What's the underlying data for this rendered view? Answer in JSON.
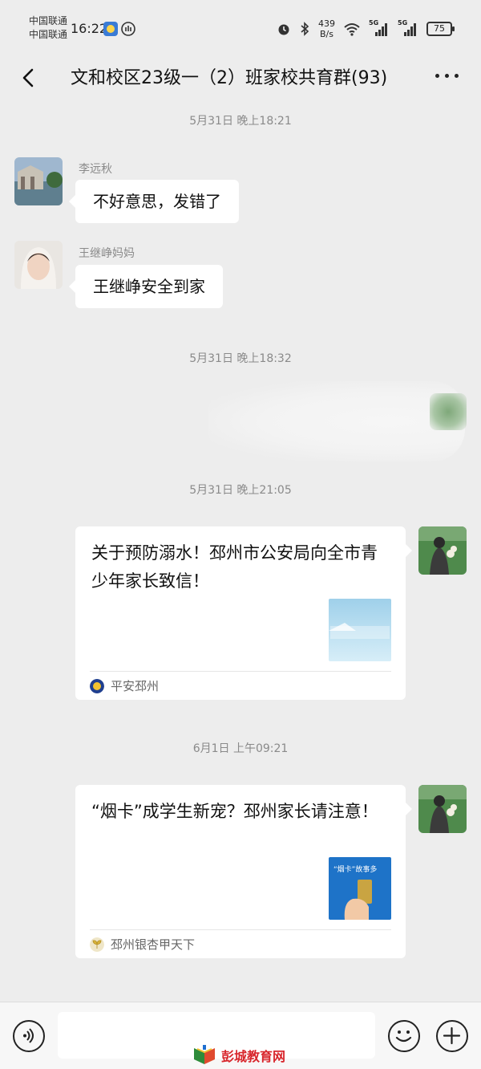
{
  "status_bar": {
    "carrier_1": "中国联通",
    "carrier_2": "中国联通",
    "time": "16:22",
    "net_speed_value": "439",
    "net_speed_unit": "B/s",
    "signal_label_1": "5G",
    "signal_label_2": "5G",
    "battery": "75"
  },
  "nav": {
    "title": "文和校区23级一（2）班家校共育群(93)"
  },
  "timestamps": {
    "t1": "5月31日 晚上18:21",
    "t2": "5月31日 晚上18:32",
    "t3": "5月31日 晚上21:05",
    "t4": "6月1日 上午09:21"
  },
  "messages": [
    {
      "sender": "李远秋",
      "text": "不好意思，发错了"
    },
    {
      "sender": "王继峥妈妈",
      "text": "王继峥安全到家"
    }
  ],
  "cards": [
    {
      "title": "关于预防溺水！邳州市公安局向全市青少年家长致信！",
      "source": "平安邳州"
    },
    {
      "title": "“烟卡”成学生新宠？邳州家长请注意！",
      "source": "邳州银杏甲天下",
      "thumb_caption": "“烟卡”故事多"
    }
  ],
  "watermark": "彭城教育网",
  "colors": {
    "background": "#ededed",
    "bubble": "#ffffff",
    "timestamp_text": "#8a8a8a",
    "watermark": "#d8262c"
  }
}
